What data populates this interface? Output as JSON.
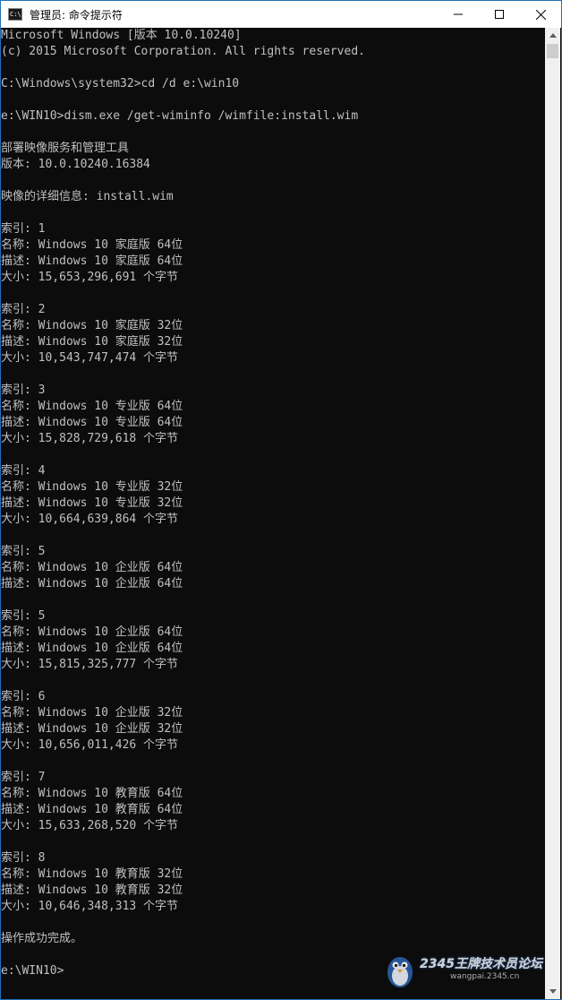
{
  "window": {
    "title": "管理员: 命令提示符",
    "icon_text": "C:\\"
  },
  "console": {
    "lines": [
      "Microsoft Windows [版本 10.0.10240]",
      "(c) 2015 Microsoft Corporation. All rights reserved.",
      "",
      "C:\\Windows\\system32>cd /d e:\\win10",
      "",
      "e:\\WIN10>dism.exe /get-wiminfo /wimfile:install.wim",
      "",
      "部署映像服务和管理工具",
      "版本: 10.0.10240.16384",
      "",
      "映像的详细信息: install.wim",
      "",
      "索引: 1",
      "名称: Windows 10 家庭版 64位",
      "描述: Windows 10 家庭版 64位",
      "大小: 15,653,296,691 个字节",
      "",
      "索引: 2",
      "名称: Windows 10 家庭版 32位",
      "描述: Windows 10 家庭版 32位",
      "大小: 10,543,747,474 个字节",
      "",
      "索引: 3",
      "名称: Windows 10 专业版 64位",
      "描述: Windows 10 专业版 64位",
      "大小: 15,828,729,618 个字节",
      "",
      "索引: 4",
      "名称: Windows 10 专业版 32位",
      "描述: Windows 10 专业版 32位",
      "大小: 10,664,639,864 个字节",
      "",
      "索引: 5",
      "名称: Windows 10 企业版 64位",
      "描述: Windows 10 企业版 64位",
      "",
      "索引: 5",
      "名称: Windows 10 企业版 64位",
      "描述: Windows 10 企业版 64位",
      "大小: 15,815,325,777 个字节",
      "",
      "索引: 6",
      "名称: Windows 10 企业版 32位",
      "描述: Windows 10 企业版 32位",
      "大小: 10,656,011,426 个字节",
      "",
      "索引: 7",
      "名称: Windows 10 教育版 64位",
      "描述: Windows 10 教育版 64位",
      "大小: 15,633,268,520 个字节",
      "",
      "索引: 8",
      "名称: Windows 10 教育版 32位",
      "描述: Windows 10 教育版 32位",
      "大小: 10,646,348,313 个字节",
      "",
      "操作成功完成。",
      "",
      "e:\\WIN10>"
    ]
  },
  "watermark": {
    "brand": "2345王牌技术员论坛",
    "url": "wangpai.2345.cn"
  },
  "icons": {
    "minimize": "minimize-icon",
    "maximize": "maximize-icon",
    "close": "close-icon",
    "scroll_up": "scroll-up-arrow-icon",
    "scroll_down": "scroll-down-arrow-icon"
  },
  "colors": {
    "console_bg": "#0c0c0c",
    "console_text": "#c0c0c0",
    "window_border": "#1e6fb8"
  }
}
